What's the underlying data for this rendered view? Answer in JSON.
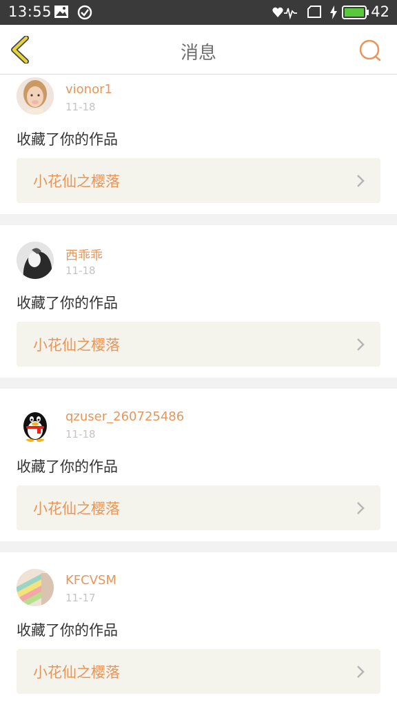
{
  "status_bar": {
    "time": "13:55",
    "battery": "42",
    "icons": [
      "image-icon",
      "check-circle-icon",
      "wifi-heart-icon",
      "sim-icon",
      "charging-icon",
      "battery-icon"
    ]
  },
  "header": {
    "title": "消息",
    "back_icon": "chevron-left-icon",
    "search_icon": "search-icon",
    "accent": "#e8955a",
    "back_color": "#e6d33a"
  },
  "notifications": [
    {
      "username": "vionor1",
      "date": "11-18",
      "action": "收藏了你的作品",
      "work_title": "小花仙之樱落"
    },
    {
      "username": "西乖乖",
      "date": "11-18",
      "action": "收藏了你的作品",
      "work_title": "小花仙之樱落"
    },
    {
      "username": "qzuser_260725486",
      "date": "11-18",
      "action": "收藏了你的作品",
      "work_title": "小花仙之樱落"
    },
    {
      "username": "KFCVSM",
      "date": "11-17",
      "action": "收藏了你的作品",
      "work_title": "小花仙之樱落"
    }
  ]
}
